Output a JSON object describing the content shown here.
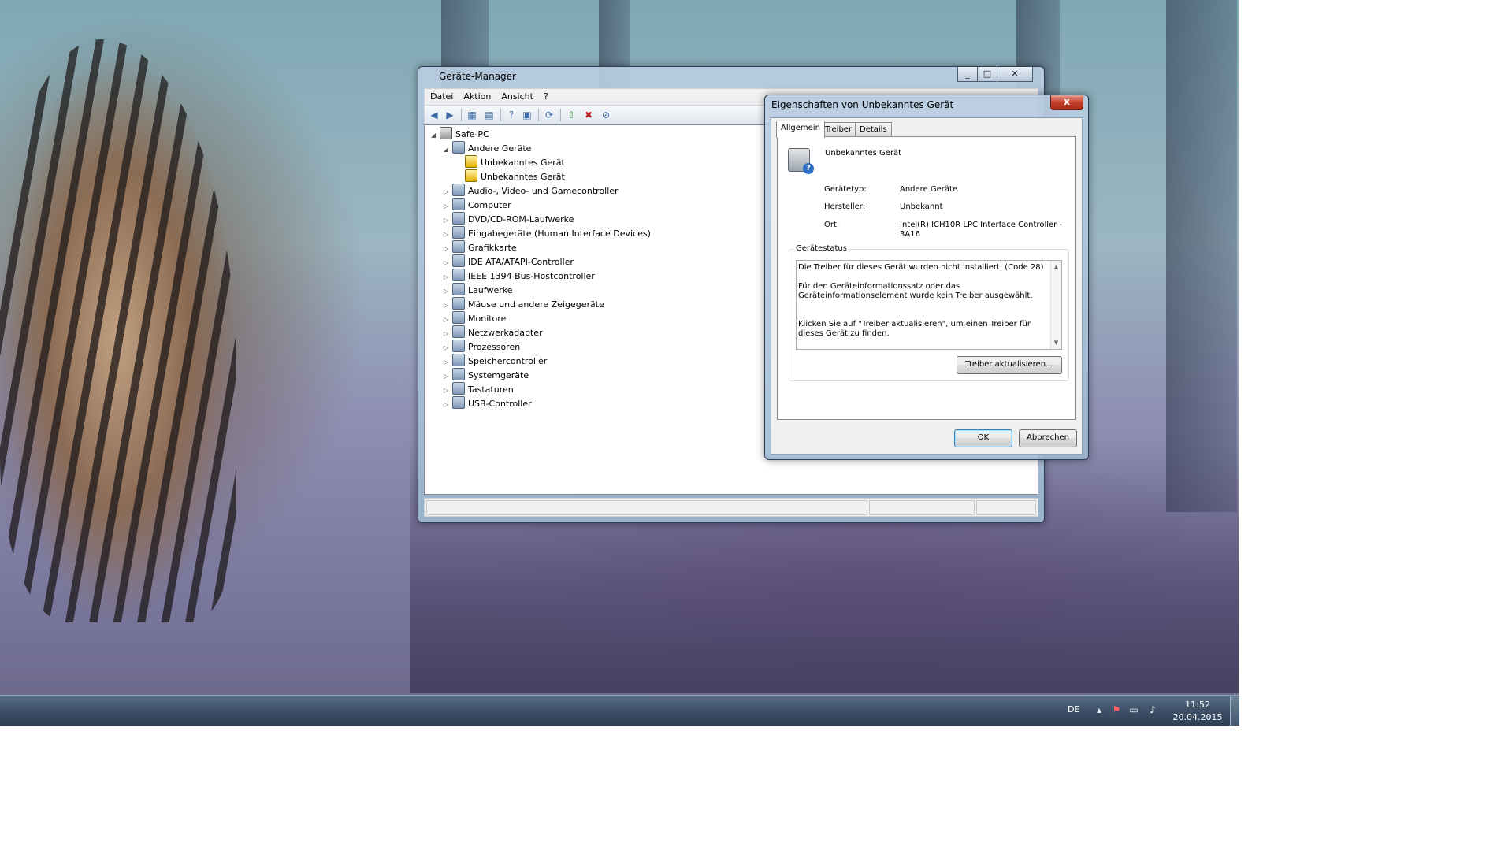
{
  "devmgr": {
    "title": "Geräte-Manager",
    "menu": [
      "Datei",
      "Aktion",
      "Ansicht",
      "?"
    ],
    "tree": [
      {
        "label": "Safe-PC",
        "level": 0,
        "arrow": "◢",
        "icon": "computer-root-icon"
      },
      {
        "label": "Andere Geräte",
        "level": 1,
        "arrow": "◢",
        "icon": "other-devices-icon"
      },
      {
        "label": "Unbekanntes Gerät",
        "level": 2,
        "arrow": "",
        "icon": "unknown-device-warning-icon"
      },
      {
        "label": "Unbekanntes Gerät",
        "level": 2,
        "arrow": "",
        "icon": "unknown-device-warning-icon"
      },
      {
        "label": "Audio-, Video- und Gamecontroller",
        "level": 1,
        "arrow": "▷",
        "icon": "audio-icon"
      },
      {
        "label": "Computer",
        "level": 1,
        "arrow": "▷",
        "icon": "computer-icon"
      },
      {
        "label": "DVD/CD-ROM-Laufwerke",
        "level": 1,
        "arrow": "▷",
        "icon": "dvd-drive-icon"
      },
      {
        "label": "Eingabegeräte (Human Interface Devices)",
        "level": 1,
        "arrow": "▷",
        "icon": "hid-icon"
      },
      {
        "label": "Grafikkarte",
        "level": 1,
        "arrow": "▷",
        "icon": "display-adapter-icon"
      },
      {
        "label": "IDE ATA/ATAPI-Controller",
        "level": 1,
        "arrow": "▷",
        "icon": "ide-controller-icon"
      },
      {
        "label": "IEEE 1394 Bus-Hostcontroller",
        "level": 1,
        "arrow": "▷",
        "icon": "ieee1394-icon"
      },
      {
        "label": "Laufwerke",
        "level": 1,
        "arrow": "▷",
        "icon": "disk-drive-icon"
      },
      {
        "label": "Mäuse und andere Zeigegeräte",
        "level": 1,
        "arrow": "▷",
        "icon": "mouse-icon"
      },
      {
        "label": "Monitore",
        "level": 1,
        "arrow": "▷",
        "icon": "monitor-icon"
      },
      {
        "label": "Netzwerkadapter",
        "level": 1,
        "arrow": "▷",
        "icon": "network-adapter-icon"
      },
      {
        "label": "Prozessoren",
        "level": 1,
        "arrow": "▷",
        "icon": "processor-icon"
      },
      {
        "label": "Speichercontroller",
        "level": 1,
        "arrow": "▷",
        "icon": "storage-controller-icon"
      },
      {
        "label": "Systemgeräte",
        "level": 1,
        "arrow": "▷",
        "icon": "system-devices-icon"
      },
      {
        "label": "Tastaturen",
        "level": 1,
        "arrow": "▷",
        "icon": "keyboard-icon"
      },
      {
        "label": "USB-Controller",
        "level": 1,
        "arrow": "▷",
        "icon": "usb-controller-icon"
      }
    ]
  },
  "props": {
    "title": "Eigenschaften von Unbekanntes Gerät",
    "close": "x",
    "tabs": [
      "Allgemein",
      "Treiber",
      "Details"
    ],
    "device_name": "Unbekanntes Gerät",
    "fields": [
      {
        "label": "Gerätetyp:",
        "value": "Andere Geräte"
      },
      {
        "label": "Hersteller:",
        "value": "Unbekannt"
      },
      {
        "label": "Ort:",
        "value": "Intel(R) ICH10R LPC Interface Controller - 3A16"
      }
    ],
    "status_group": "Gerätestatus",
    "status_text": "Die Treiber für dieses Gerät wurden nicht installiert. (Code 28)\n\nFür den Geräteinformationssatz oder das Geräteinformationselement wurde kein Treiber ausgewählt.\n\n\nKlicken Sie auf \"Treiber aktualisieren\", um einen Treiber für dieses Gerät zu finden.",
    "update_button": "Treiber aktualisieren...",
    "ok_button": "OK",
    "cancel_button": "Abbrechen"
  },
  "taskbar": {
    "language": "DE",
    "time": "11:52",
    "date": "20.04.2015"
  }
}
